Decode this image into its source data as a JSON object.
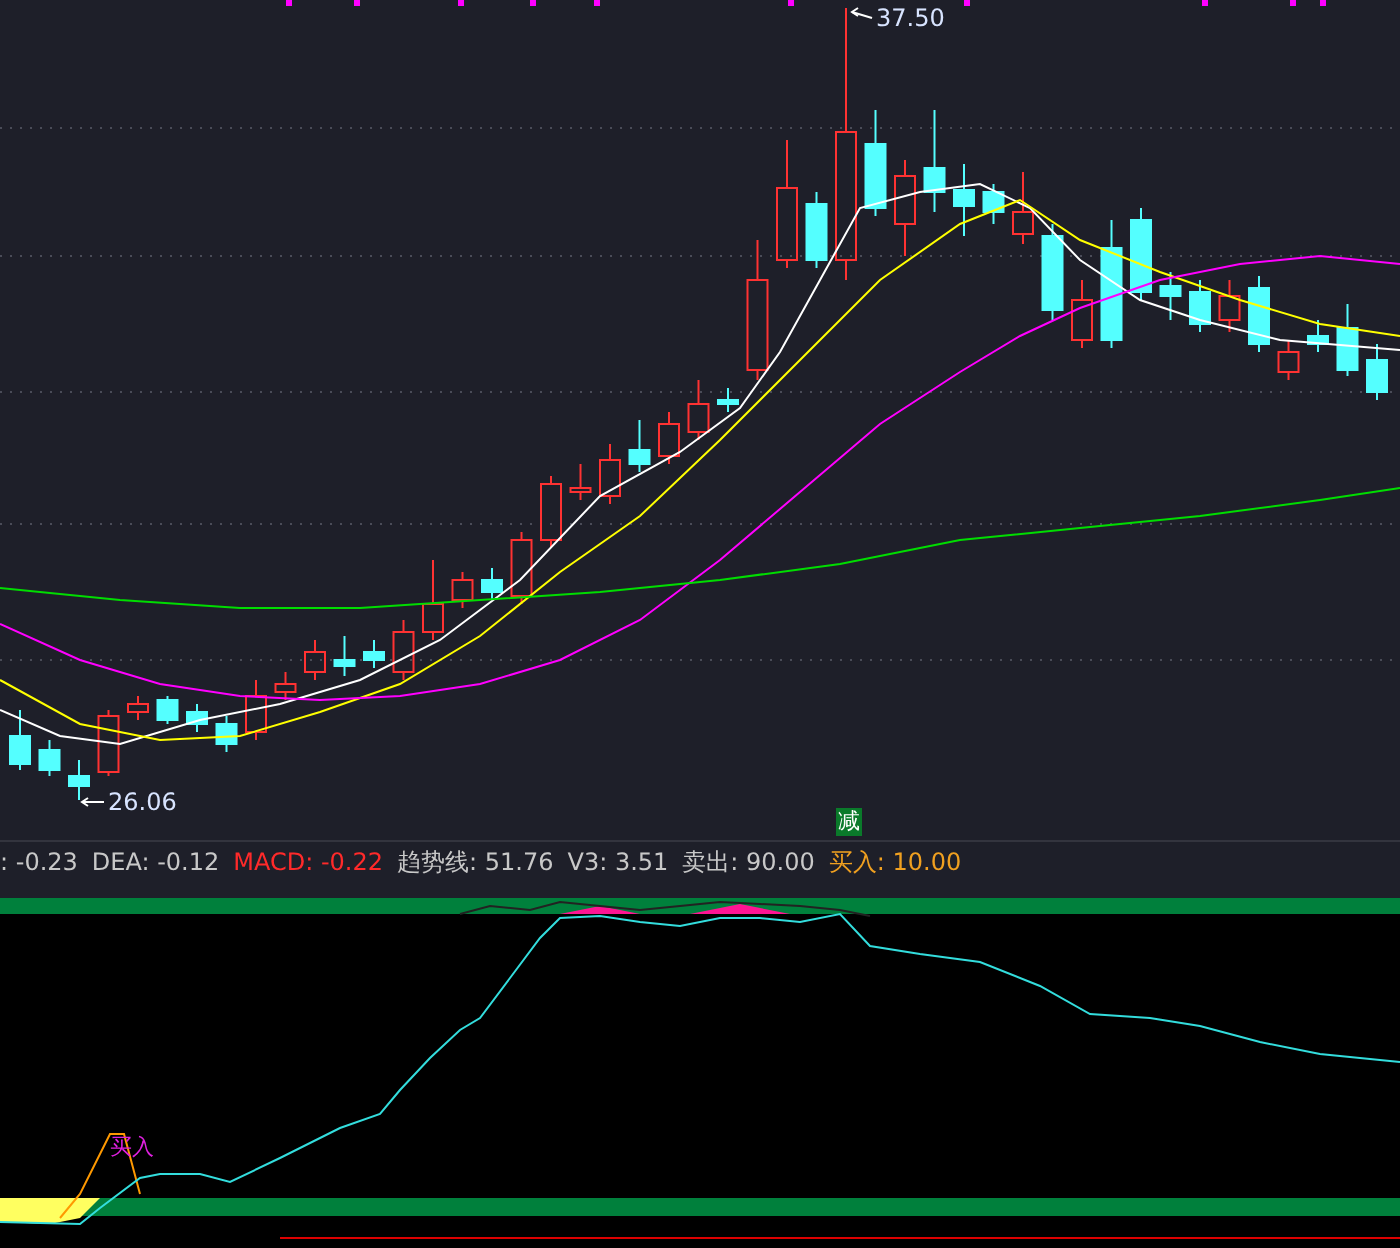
{
  "price_chart": {
    "high_label": "37.50",
    "low_label": "26.06",
    "signal_badge": "减"
  },
  "indicator_legend": [
    {
      "text": ": -0.23",
      "color": "#c8c8c8"
    },
    {
      "text": "DEA: -0.12",
      "color": "#c8c8c8"
    },
    {
      "text": "MACD: -0.22",
      "color": "#ff2a2a"
    },
    {
      "text": "趋势线: 51.76",
      "color": "#c8c8c8"
    },
    {
      "text": "V3: 3.51",
      "color": "#c8c8c8"
    },
    {
      "text": "卖出: 90.00",
      "color": "#c8c8c8"
    },
    {
      "text": "买入: 10.00",
      "color": "#f0a020"
    }
  ],
  "indicator_chart": {
    "signal_label": "买入"
  }
}
